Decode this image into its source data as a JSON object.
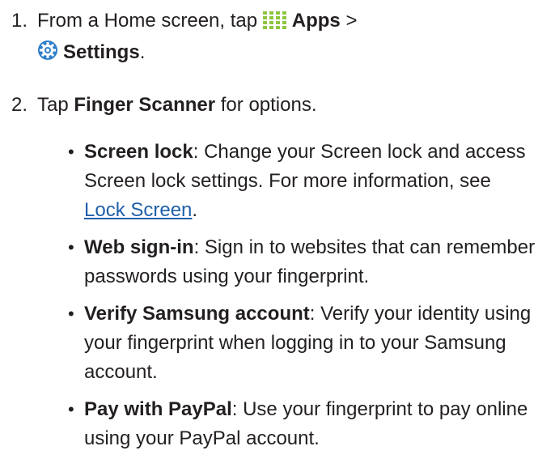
{
  "steps": [
    {
      "number": "1.",
      "prefix": "From a Home screen, tap",
      "apps_icon": "apps-grid-icon",
      "apps_label": "Apps",
      "separator": ">",
      "settings_icon": "settings-gear-icon",
      "settings_label": "Settings",
      "suffix": "."
    },
    {
      "number": "2.",
      "prefix": "Tap",
      "bold": "Finger Scanner",
      "suffix": "for options."
    }
  ],
  "options": [
    {
      "bullet": "•",
      "title": "Screen lock",
      "text": ": Change your Screen lock and access Screen lock settings. For more information, see",
      "link": "Lock Screen",
      "after_link": "."
    },
    {
      "bullet": "•",
      "title": "Web sign-in",
      "text": ": Sign in to websites that can remember passwords using your fingerprint."
    },
    {
      "bullet": "•",
      "title": "Verify Samsung account",
      "text": ": Verify your identity using your fingerprint when logging in to your Samsung account."
    },
    {
      "bullet": "•",
      "title": "Pay with PayPal",
      "text": ": Use your fingerprint to pay online using your PayPal account."
    }
  ],
  "colors": {
    "text": "#231f20",
    "link": "#1f5fa9",
    "icon_green": "#8cc63f",
    "icon_blue": "#2e7ec9"
  }
}
